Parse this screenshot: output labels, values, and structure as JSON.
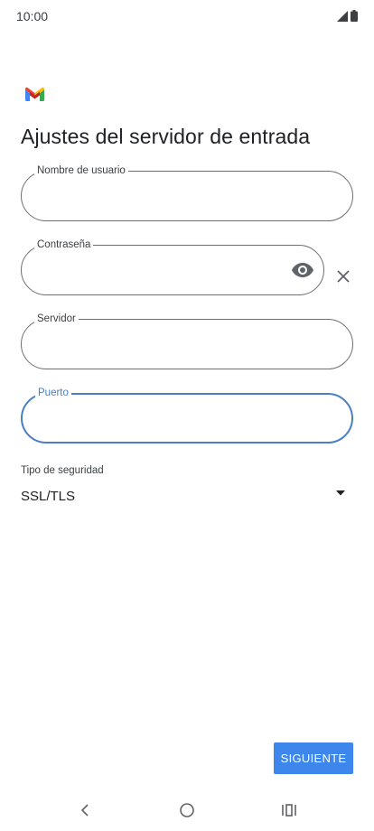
{
  "status_bar": {
    "time": "10:00"
  },
  "icons": {
    "signal": "signal-icon",
    "battery": "battery-icon",
    "logo": "gmail-logo-icon",
    "eye": "eye-icon",
    "clear": "close-icon",
    "dropdown": "dropdown-arrow-icon",
    "back": "back-icon",
    "home": "home-icon",
    "recents": "recents-icon"
  },
  "colors": {
    "accent": "#3d86ec",
    "focus": "#4a7fc1",
    "outline": "#6f6f6f",
    "gmail_red": "#ea4335",
    "gmail_blue": "#4285f4",
    "gmail_green": "#34a853",
    "gmail_yellow": "#fbbc04"
  },
  "page": {
    "title": "Ajustes del servidor de entrada"
  },
  "form": {
    "username": {
      "label": "Nombre de usuario",
      "value": ""
    },
    "password": {
      "label": "Contraseña",
      "value": ""
    },
    "server": {
      "label": "Servidor",
      "value": ""
    },
    "port": {
      "label": "Puerto",
      "value": ""
    },
    "security": {
      "label": "Tipo de seguridad",
      "value": "SSL/TLS"
    }
  },
  "actions": {
    "next_label": "SIGUIENTE"
  }
}
